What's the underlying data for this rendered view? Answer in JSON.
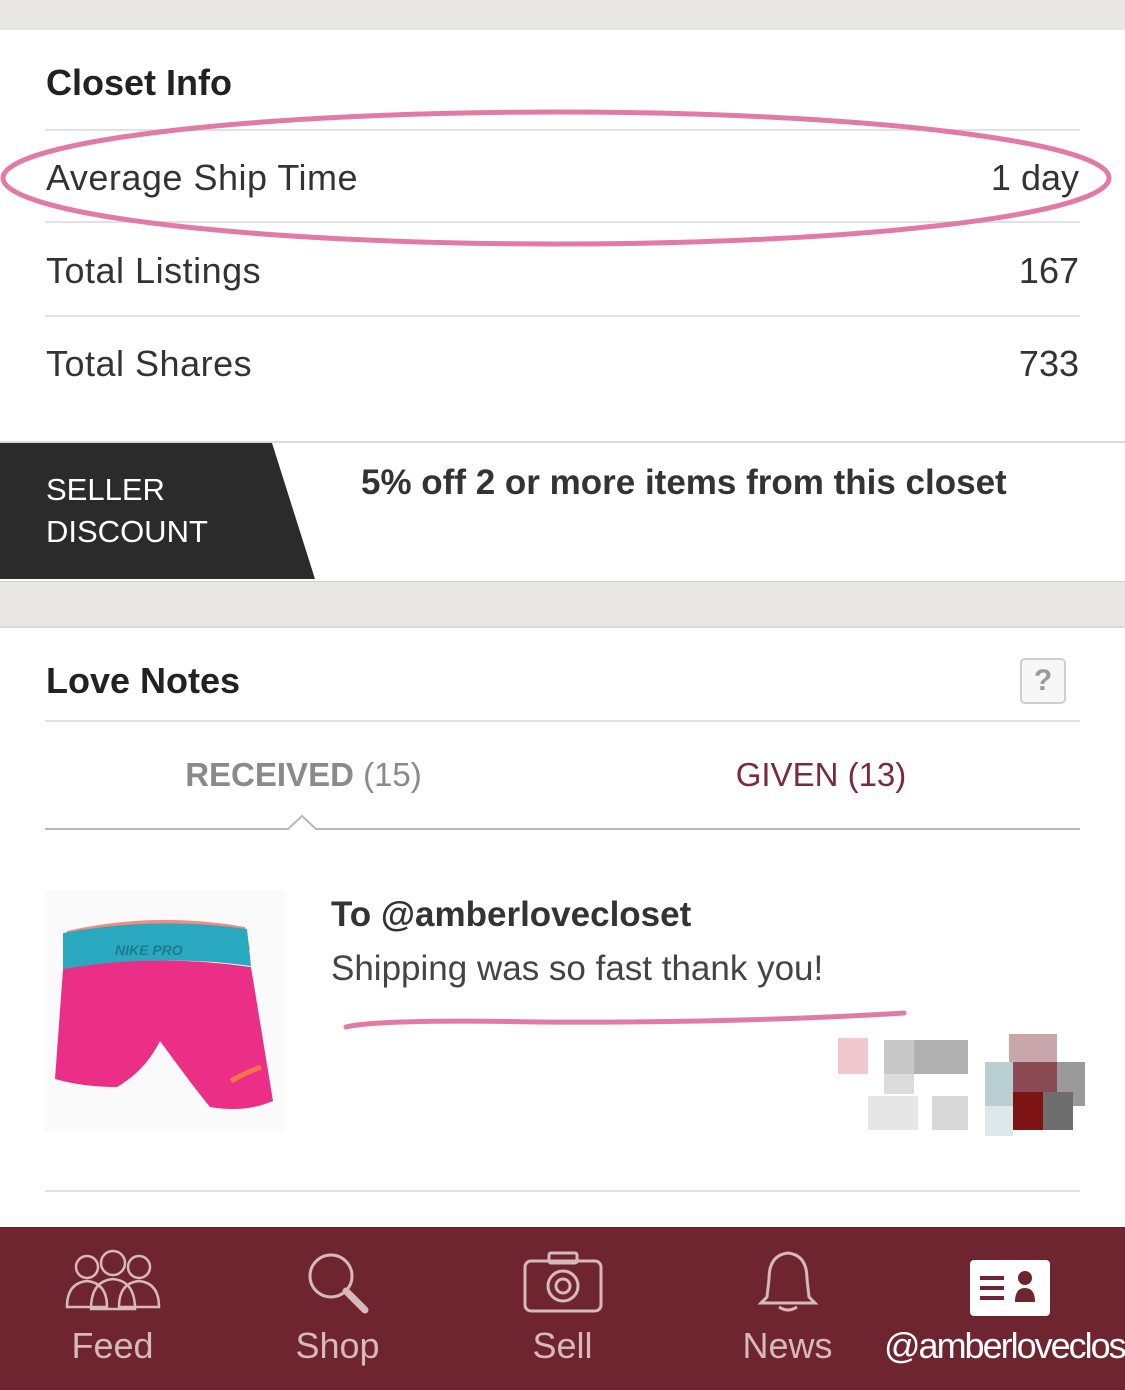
{
  "closet_info": {
    "title": "Closet Info",
    "rows": [
      {
        "label": "Average Ship Time",
        "value": "1 day"
      },
      {
        "label": "Total Listings",
        "value": "167"
      },
      {
        "label": "Total Shares",
        "value": "733"
      }
    ]
  },
  "seller_discount": {
    "badge_line1": "SELLER",
    "badge_line2": "DISCOUNT",
    "text": "5% off 2 or more items from this closet"
  },
  "love_notes": {
    "title": "Love Notes",
    "help_label": "?",
    "tabs": [
      {
        "label": "RECEIVED",
        "count": "(15)",
        "selected": true
      },
      {
        "label": "GIVEN",
        "count": "(13)",
        "selected": false
      }
    ],
    "note": {
      "recipient": "To @amberlovecloset",
      "message": "Shipping was so fast thank you!",
      "image_label": "NIKE PRO"
    }
  },
  "bottom_nav": {
    "items": [
      {
        "label": "Feed",
        "icon": "people-icon"
      },
      {
        "label": "Shop",
        "icon": "search-icon"
      },
      {
        "label": "Sell",
        "icon": "camera-icon"
      },
      {
        "label": "News",
        "icon": "bell-icon"
      },
      {
        "label": "@amberlovecloset",
        "icon": "closet-profile-icon",
        "active": true
      }
    ]
  },
  "colors": {
    "nav_background": "#6e2530",
    "accent": "#7a2a3a",
    "highlight_pink": "#e27aa6",
    "badge_dark": "#2b2b2b"
  }
}
